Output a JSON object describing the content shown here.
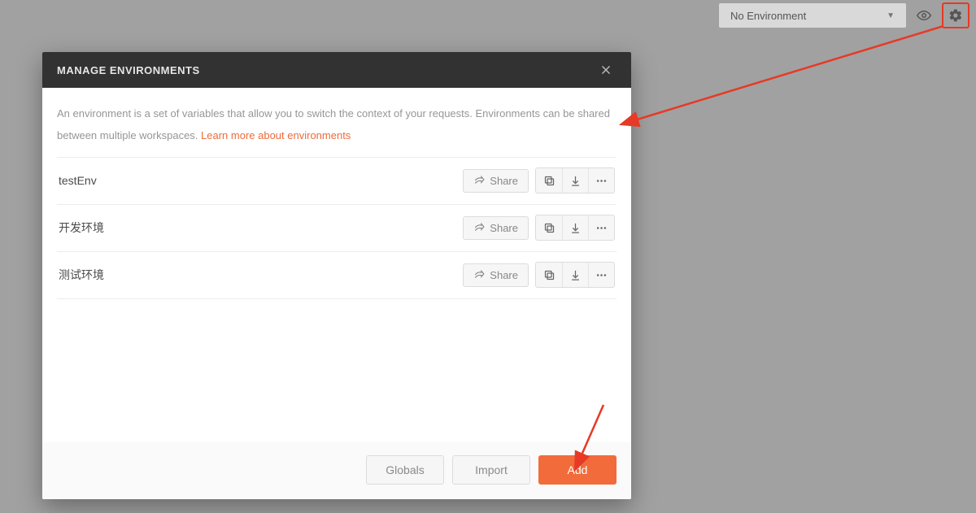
{
  "topbar": {
    "env_label": "No Environment"
  },
  "modal": {
    "title": "MANAGE ENVIRONMENTS",
    "description_pre": "An environment is a set of variables that allow you to switch the context of your requests. Environments can be shared between multiple workspaces. ",
    "learn_more": "Learn more about environments",
    "share_label": "Share",
    "environments": [
      {
        "name": "testEnv"
      },
      {
        "name": "开发环境"
      },
      {
        "name": "测试环境"
      }
    ],
    "footer": {
      "globals": "Globals",
      "import": "Import",
      "add": "Add"
    }
  }
}
